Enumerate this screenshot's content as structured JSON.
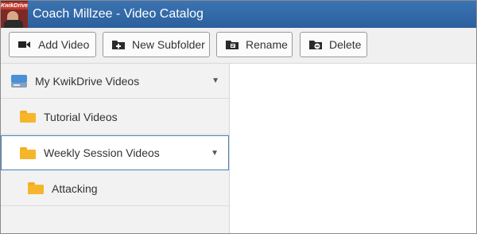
{
  "window": {
    "title": "Coach Millzee - Video Catalog",
    "logo_text": "KwikDrive"
  },
  "toolbar": {
    "add_video": "Add Video",
    "new_subfolder": "New Subfolder",
    "rename": "Rename",
    "delete": "Delete"
  },
  "tree": {
    "root": "My KwikDrive Videos",
    "items": [
      {
        "label": "Tutorial Videos"
      },
      {
        "label": "Weekly Session Videos",
        "selected": true,
        "expanded": true
      },
      {
        "label": "Attacking"
      }
    ]
  },
  "icons": {
    "chevron": "▼",
    "folder_color": "#f7b52c",
    "title_bar_color": "#2f66a5",
    "selection_border": "#4a7fb8"
  }
}
